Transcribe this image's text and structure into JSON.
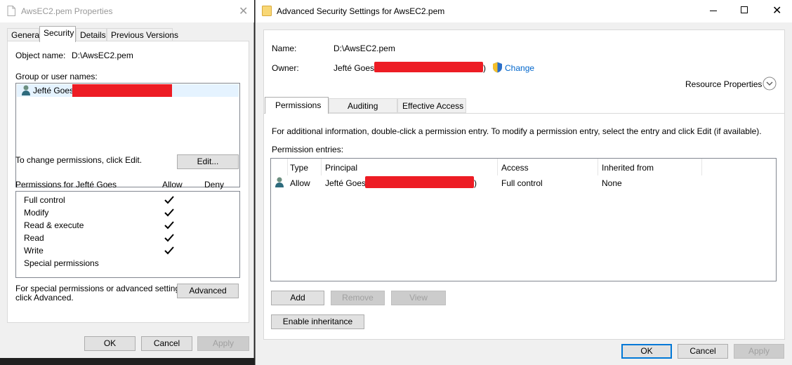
{
  "properties": {
    "title": "AwsEC2.pem Properties",
    "tabs": [
      "General",
      "Security",
      "Details",
      "Previous Versions"
    ],
    "object_name_label": "Object name:",
    "object_name_value": "D:\\AwsEC2.pem",
    "group_label": "Group or user names:",
    "user_name": "Jefté Goes",
    "change_perm_text": "To change permissions, click Edit.",
    "edit_button": "Edit...",
    "perm_for_label": "Permissions for Jefté Goes",
    "allow_header": "Allow",
    "deny_header": "Deny",
    "permissions": [
      {
        "name": "Full control",
        "allow": true
      },
      {
        "name": "Modify",
        "allow": true
      },
      {
        "name": "Read & execute",
        "allow": true
      },
      {
        "name": "Read",
        "allow": true
      },
      {
        "name": "Write",
        "allow": true
      },
      {
        "name": "Special permissions",
        "allow": false
      }
    ],
    "special_text_1": "For special permissions or advanced settings,",
    "special_text_2": "click Advanced.",
    "advanced_button": "Advanced",
    "ok": "OK",
    "cancel": "Cancel",
    "apply": "Apply"
  },
  "advanced": {
    "title": "Advanced Security Settings for AwsEC2.pem",
    "name_label": "Name:",
    "name_value": "D:\\AwsEC2.pem",
    "owner_label": "Owner:",
    "owner_value": "Jefté Goes",
    "owner_close_paren": ")",
    "change_link": "Change",
    "resource_properties": "Resource Properties",
    "tabs": [
      "Permissions",
      "Auditing",
      "Effective Access"
    ],
    "info_text": "For additional information, double-click a permission entry. To modify a permission entry, select the entry and click Edit (if available).",
    "entries_label": "Permission entries:",
    "columns": [
      "Type",
      "Principal",
      "Access",
      "Inherited from"
    ],
    "row": {
      "type": "Allow",
      "principal": "Jefté Goes",
      "principal_close_paren": ")",
      "access": "Full control",
      "inherited": "None"
    },
    "add": "Add",
    "remove": "Remove",
    "view": "View",
    "enable_inheritance": "Enable inheritance",
    "ok": "OK",
    "cancel": "Cancel",
    "apply": "Apply"
  },
  "colors": {
    "redaction": "#ed1c24",
    "focus_blue": "#0078d7",
    "link": "#0066cc"
  }
}
